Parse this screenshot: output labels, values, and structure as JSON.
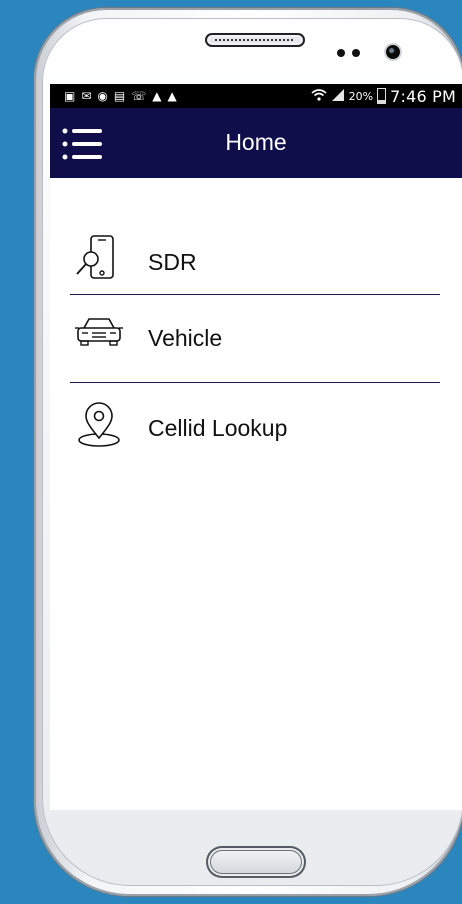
{
  "statusbar": {
    "icons": [
      "notification-icon",
      "mail-icon",
      "gps-icon",
      "gallery-icon",
      "whatsapp-icon",
      "warning-icon",
      "warning-icon"
    ],
    "battery_percent": "20%",
    "time": "7:46 PM"
  },
  "appbar": {
    "title": "Home"
  },
  "menu": [
    {
      "label": "SDR",
      "icon": "phone-search-icon"
    },
    {
      "label": "Vehicle",
      "icon": "car-icon"
    },
    {
      "label": "Cellid Lookup",
      "icon": "map-pin-icon"
    }
  ]
}
